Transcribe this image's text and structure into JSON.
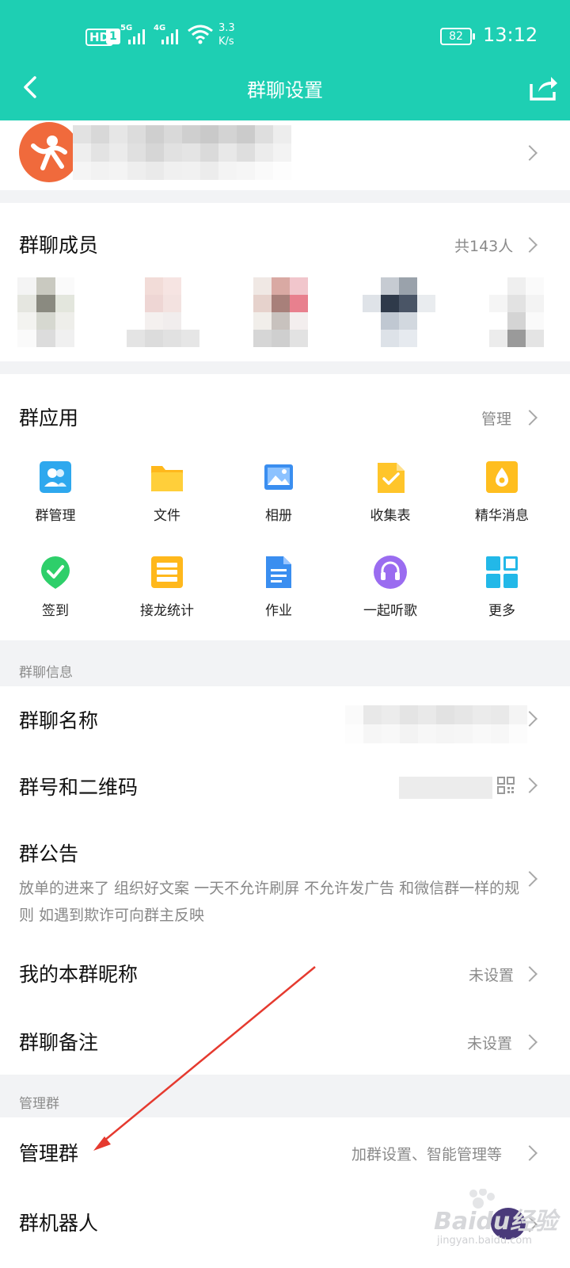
{
  "status_bar": {
    "hd": "HD",
    "sim": "1",
    "net1": "5G",
    "net2": "4G",
    "speed_value": "3.3",
    "speed_unit": "K/s",
    "battery": "82",
    "time": "13:12"
  },
  "header": {
    "title": "群聊设置"
  },
  "members": {
    "title": "群聊成员",
    "count": "共143人"
  },
  "group_apps": {
    "title": "群应用",
    "manage": "管理",
    "items": [
      {
        "label": "群管理",
        "icon": "group-manage-icon",
        "color": "#2ea8ee"
      },
      {
        "label": "文件",
        "icon": "folder-icon",
        "color": "#ffc125"
      },
      {
        "label": "相册",
        "icon": "photo-album-icon",
        "color": "#3a8ef0"
      },
      {
        "label": "收集表",
        "icon": "collect-form-icon",
        "color": "#ffc52a"
      },
      {
        "label": "精华消息",
        "icon": "essence-message-icon",
        "color": "#ffbe1f"
      },
      {
        "label": "签到",
        "icon": "check-in-icon",
        "color": "#2ecf6a"
      },
      {
        "label": "接龙统计",
        "icon": "relay-stats-icon",
        "color": "#ffb81c"
      },
      {
        "label": "作业",
        "icon": "homework-icon",
        "color": "#3a8ef0"
      },
      {
        "label": "一起听歌",
        "icon": "headphones-icon",
        "color": "#9a6cf0"
      },
      {
        "label": "更多",
        "icon": "more-grid-icon",
        "color": "#22b8e8"
      }
    ]
  },
  "group_info": {
    "label": "群聊信息",
    "name_title": "群聊名称",
    "qr_title": "群号和二维码",
    "notice_title": "群公告",
    "notice_text": "放单的进来了 组织好文案 一天不允许刷屏 不允许发广告 和微信群一样的规则 如遇到欺诈可向群主反映",
    "nickname_title": "我的本群昵称",
    "nickname_value": "未设置",
    "remark_title": "群聊备注",
    "remark_value": "未设置"
  },
  "manage_group": {
    "label": "管理群",
    "title": "管理群",
    "value": "加群设置、智能管理等",
    "robot_title": "群机器人"
  },
  "watermark": {
    "brand": "Baidu经验",
    "url": "jingyan.baidu.com"
  },
  "colors": {
    "header": "#1ecfb3",
    "annotation_arrow": "#e53a2f"
  }
}
